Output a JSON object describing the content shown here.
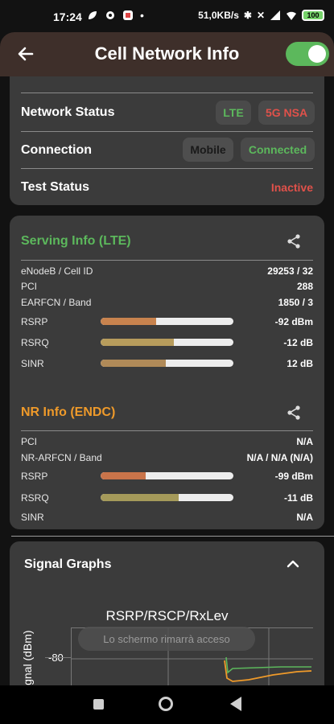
{
  "statusbar": {
    "time": "17:24",
    "net_speed": "51,0KB/s",
    "battery": "100"
  },
  "header": {
    "title": "Cell Network Info",
    "toggle_on": true
  },
  "status_card": {
    "network_status_label": "Network Status",
    "network_badges": [
      "LTE",
      "5G NSA"
    ],
    "connection_label": "Connection",
    "connection_badges": [
      "Mobile",
      "Connected"
    ],
    "test_status_label": "Test Status",
    "test_status_value": "Inactive"
  },
  "serving": {
    "title": "Serving Info (LTE)",
    "rows": [
      {
        "label": "eNodeB / Cell ID",
        "value": "29253 / 32"
      },
      {
        "label": "PCI",
        "value": "288"
      },
      {
        "label": "EARFCN / Band",
        "value": "1850 / 3"
      }
    ],
    "bars": [
      {
        "label": "RSRP",
        "value": "-92 dBm",
        "level": 0.42,
        "color": "#c8834e"
      },
      {
        "label": "RSRQ",
        "value": "-12 dB",
        "level": 0.55,
        "color": "#b79c5c"
      },
      {
        "label": "SINR",
        "value": "12 dB",
        "level": 0.49,
        "color": "#b08a58"
      }
    ]
  },
  "nr": {
    "title": "NR Info (ENDC)",
    "rows": [
      {
        "label": "PCI",
        "value": "N/A"
      },
      {
        "label": "NR-ARFCN / Band",
        "value": "N/A / N/A (N/A)"
      }
    ],
    "bars": [
      {
        "label": "RSRP",
        "value": "-99 dBm",
        "level": 0.34,
        "color": "#c9744a"
      },
      {
        "label": "RSRQ",
        "value": "-11 dB",
        "level": 0.59,
        "color": "#a59a5a"
      }
    ],
    "sinr_label": "SINR",
    "sinr_value": "N/A"
  },
  "graphs": {
    "title": "Signal Graphs",
    "chart_title": "RSRP/RSCP/RxLev",
    "y_axis_label": "ignal (dBm)",
    "y_tick": "-80",
    "toast": "Lo schermo rimarrà acceso"
  },
  "colors": {
    "green": "#5cb85c",
    "red": "#e0514a",
    "orange": "#ef9a2a"
  }
}
